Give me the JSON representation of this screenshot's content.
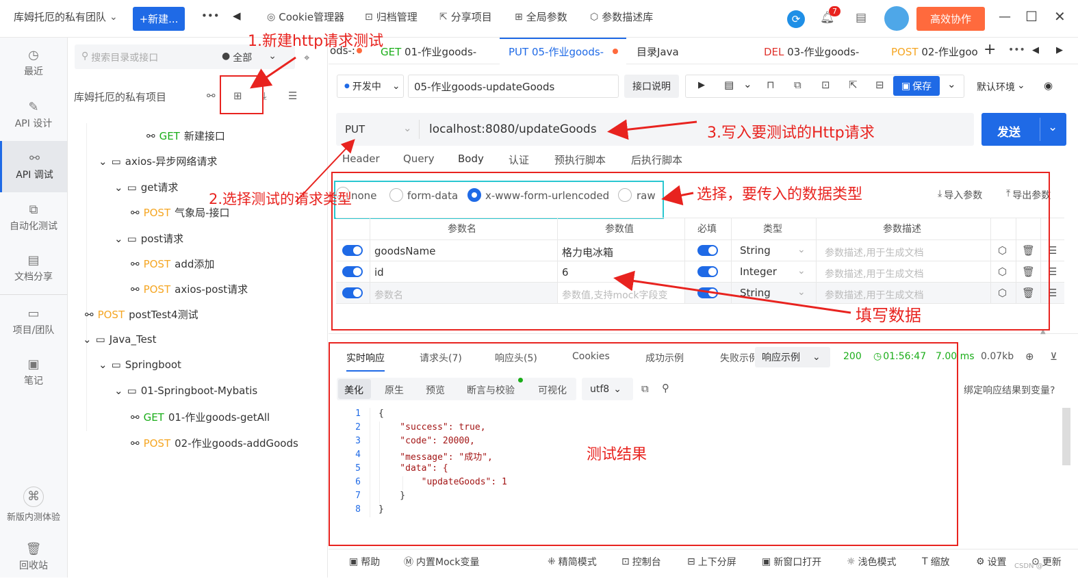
{
  "topbar": {
    "team": "库姆托厄的私有团队",
    "new_btn": "+新建...",
    "more": "•••",
    "back": "◀",
    "cookie": "Cookie管理器",
    "archive": "归档管理",
    "share": "分享项目",
    "global": "全局参数",
    "desc_lib": "参数描述库",
    "badge": "7",
    "collab": "高效协作"
  },
  "rail": [
    {
      "label": "最近",
      "icon": "clock-icon"
    },
    {
      "label": "API 设计",
      "icon": "edit-icon"
    },
    {
      "label": "API 调试",
      "icon": "link-icon"
    },
    {
      "label": "自动化测试",
      "icon": "flow-icon"
    },
    {
      "label": "文档分享",
      "icon": "doc-icon"
    },
    {
      "label": "项目/团队",
      "icon": "folder-icon"
    },
    {
      "label": "笔记",
      "icon": "note-icon"
    },
    {
      "label": "新版内测体验",
      "icon": "beta-icon"
    },
    {
      "label": "回收站",
      "icon": "trash-icon"
    }
  ],
  "tree": {
    "search_placeholder": "搜索目录或接口",
    "filter": "全部",
    "project": "库姆托厄的私有项目",
    "nodes": [
      {
        "method": "GET",
        "name": "新建接口"
      },
      {
        "name": "axios-异步网络请求"
      },
      {
        "name": "get请求"
      },
      {
        "method": "POST",
        "name": "气象局-接口"
      },
      {
        "name": "post请求"
      },
      {
        "method": "POST",
        "name": "add添加"
      },
      {
        "method": "POST",
        "name": "axios-post请求"
      },
      {
        "method": "POST",
        "name": "postTest4测试"
      },
      {
        "name": "Java_Test"
      },
      {
        "name": "Springboot"
      },
      {
        "name": "01-Springboot-Mybatis"
      },
      {
        "method": "GET",
        "name": "01-作业goods-getAll"
      },
      {
        "method": "POST",
        "name": "02-作业goods-addGoods"
      }
    ]
  },
  "tabs": [
    {
      "method": "",
      "name": "ods-:"
    },
    {
      "method": "GET",
      "name": "01-作业goods-"
    },
    {
      "method": "PUT",
      "name": "05-作业goods-"
    },
    {
      "method": "",
      "name": "目录Java"
    },
    {
      "method": "DEL",
      "name": "03-作业goods-"
    },
    {
      "method": "POST",
      "name": "02-作业goo"
    }
  ],
  "request": {
    "status": "开发中",
    "name": "05-作业goods-updateGoods",
    "doc_btn": "接口说明",
    "save": "保存",
    "env": "默认环境",
    "method": "PUT",
    "url": "localhost:8080/updateGoods",
    "send": "发送"
  },
  "req_tabs": [
    "Header",
    "Query",
    "Body",
    "认证",
    "预执行脚本",
    "后执行脚本"
  ],
  "body_types": [
    "none",
    "form-data",
    "x-www-form-urlencoded",
    "raw"
  ],
  "import_params": "导入参数",
  "export_params": "导出参数",
  "table": {
    "headers": [
      "参数名",
      "参数值",
      "必填",
      "类型",
      "参数描述"
    ],
    "rows": [
      {
        "name": "goodsName",
        "value": "格力电冰箱",
        "type": "String",
        "desc": "参数描述,用于生成文档"
      },
      {
        "name": "id",
        "value": "6",
        "type": "Integer",
        "desc": "参数描述,用于生成文档"
      },
      {
        "name": "参数名",
        "value": "参数值,支持mock字段变",
        "type": "String",
        "desc": "参数描述,用于生成文档"
      }
    ]
  },
  "resp": {
    "tabs": [
      "实时响应",
      "请求头(7)",
      "响应头(5)",
      "Cookies",
      "成功示例",
      "失败示例"
    ],
    "example": "响应示例",
    "code": "200",
    "time": "01:56:47",
    "ms": "7.00 ms",
    "size": "0.07kb",
    "views": [
      "美化",
      "原生",
      "预览",
      "断言与校验",
      "可视化"
    ],
    "encoding": "utf8",
    "bind": "绑定响应结果到变量?",
    "lines": [
      "{",
      "    \"success\": true,",
      "    \"code\": 20000,",
      "    \"message\": \"成功\",",
      "    \"data\": {",
      "        \"updateGoods\": 1",
      "    }",
      "}"
    ]
  },
  "annotations": {
    "a1": "1.新建http请求测试",
    "a2": "2.选择测试的请求类型",
    "a3": "3.写入要测试的Http请求",
    "a4": "选择，要传入的数据类型",
    "a5": "填写数据",
    "a6": "测试结果"
  },
  "bottom": [
    "帮助",
    "内置Mock变量",
    "精简模式",
    "控制台",
    "上下分屏",
    "新窗口打开",
    "浅色模式",
    "缩放",
    "设置",
    "更新"
  ],
  "watermark": "CSDN @",
  "colors": {
    "accent": "#1f6ae6",
    "annotation": "#e8231f",
    "highlight": "#29c7d1",
    "collab": "#ff6a3d"
  }
}
